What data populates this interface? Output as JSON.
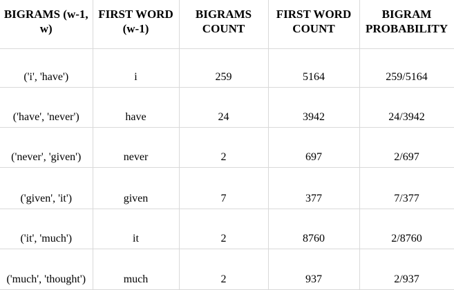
{
  "headers": [
    "BIGRAMS (w-1, w)",
    "FIRST WORD (w-1)",
    "BIGRAMS COUNT",
    "FIRST WORD COUNT",
    "BIGRAM PROBABILITY"
  ],
  "rows": [
    [
      "('i', 'have')",
      "i",
      "259",
      "5164",
      "259/5164"
    ],
    [
      "('have', 'never')",
      "have",
      "24",
      "3942",
      "24/3942"
    ],
    [
      "('never', 'given')",
      "never",
      "2",
      "697",
      "2/697"
    ],
    [
      "('given', 'it')",
      "given",
      "7",
      "377",
      "7/377"
    ],
    [
      "('it', 'much')",
      "it",
      "2",
      "8760",
      "2/8760"
    ],
    [
      "('much', 'thought')",
      "much",
      "2",
      "937",
      "2/937"
    ]
  ]
}
